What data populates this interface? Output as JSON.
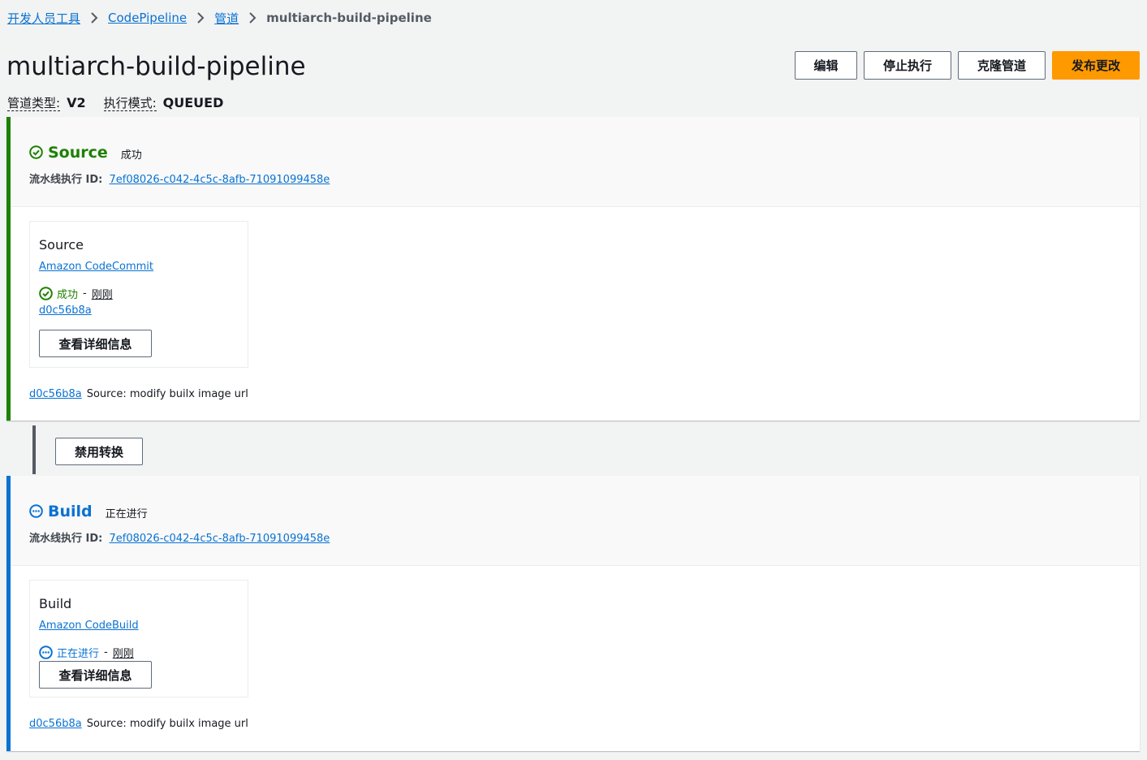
{
  "breadcrumb": {
    "items": [
      "开发人员工具",
      "CodePipeline",
      "管道"
    ],
    "current": "multiarch-build-pipeline"
  },
  "header": {
    "title": "multiarch-build-pipeline",
    "actions": {
      "edit": "编辑",
      "stop": "停止执行",
      "clone": "克隆管道",
      "release": "发布更改"
    }
  },
  "meta": {
    "pipeline_type_label": "管道类型:",
    "pipeline_type_value": "V2",
    "execution_mode_label": "执行模式:",
    "execution_mode_value": "QUEUED"
  },
  "colors": {
    "success": "#1d8102",
    "in_progress": "#0972d3",
    "primary_button": "#ff9900"
  },
  "stages": [
    {
      "name": "Source",
      "status": "成功",
      "status_icon": "check-circle-icon",
      "exec_label": "流水线执行 ID:",
      "exec_id": "7ef08026-c042-4c5c-8afb-71091099458e",
      "action": {
        "name": "Source",
        "provider": "Amazon CodeCommit",
        "status": "成功",
        "dash": "-",
        "time": "刚刚",
        "commit": "d0c56b8a",
        "details_button": "查看详细信息"
      },
      "footer": {
        "commit": "d0c56b8a",
        "message": "Source: modify builx image url"
      }
    },
    {
      "name": "Build",
      "status": "正在进行",
      "status_icon": "in-progress-icon",
      "exec_label": "流水线执行 ID:",
      "exec_id": "7ef08026-c042-4c5c-8afb-71091099458e",
      "action": {
        "name": "Build",
        "provider": "Amazon CodeBuild",
        "status": "正在进行",
        "dash": "-",
        "time": "刚刚",
        "details_button": "查看详细信息"
      },
      "footer": {
        "commit": "d0c56b8a",
        "message": "Source: modify builx image url"
      }
    }
  ],
  "transition": {
    "disable_button": "禁用转换"
  }
}
